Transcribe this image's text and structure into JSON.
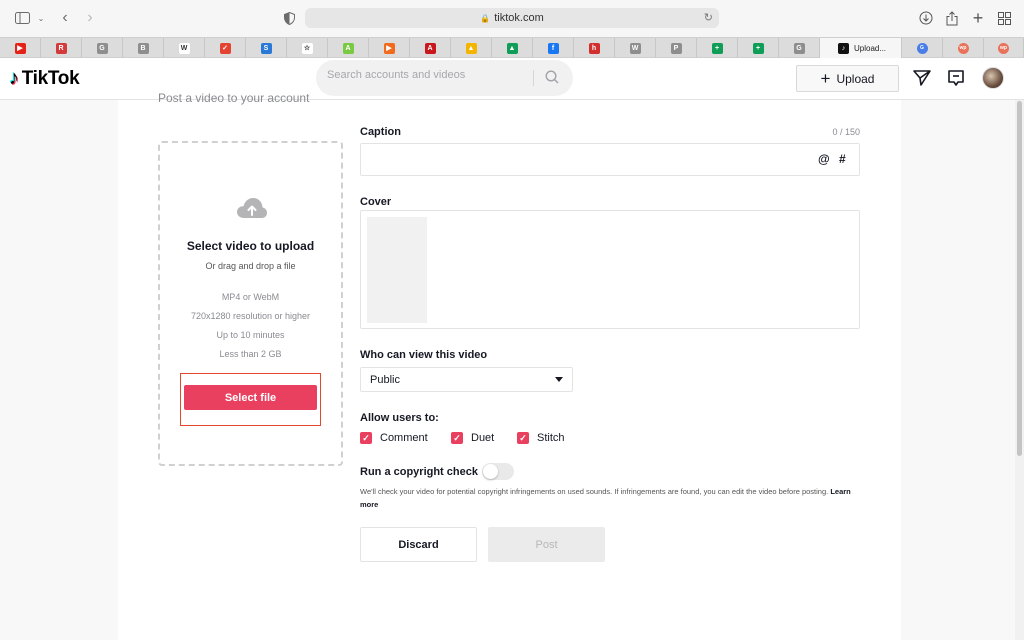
{
  "browser": {
    "url": "tiktok.com",
    "tabs": [
      {
        "name": "youtube",
        "color": "#e62117",
        "glyph": "▶"
      },
      {
        "name": "red-app",
        "color": "#d33b3b",
        "glyph": "R"
      },
      {
        "name": "g-gray-1",
        "color": "#8e8e8e",
        "glyph": "G"
      },
      {
        "name": "b-gray",
        "color": "#8e8e8e",
        "glyph": "B"
      },
      {
        "name": "wikipedia",
        "color": "#ffffff",
        "glyph": "W"
      },
      {
        "name": "todoist",
        "color": "#e44332",
        "glyph": "✓"
      },
      {
        "name": "s-blue",
        "color": "#2b79d6",
        "glyph": "S"
      },
      {
        "name": "star",
        "color": "#ffffff",
        "glyph": "☆"
      },
      {
        "name": "green-app",
        "color": "#7ac943",
        "glyph": "A"
      },
      {
        "name": "orange-play",
        "color": "#f26b1d",
        "glyph": "▶"
      },
      {
        "name": "acrobat",
        "color": "#c8181e",
        "glyph": "A"
      },
      {
        "name": "google-drive-1",
        "color": "#f4b400",
        "glyph": "▲"
      },
      {
        "name": "google-drive-2",
        "color": "#0f9d58",
        "glyph": "▲"
      },
      {
        "name": "facebook",
        "color": "#1877f2",
        "glyph": "f"
      },
      {
        "name": "hot",
        "color": "#d32f2f",
        "glyph": "h"
      },
      {
        "name": "w-gray",
        "color": "#8e8e8e",
        "glyph": "W"
      },
      {
        "name": "p-gray",
        "color": "#8e8e8e",
        "glyph": "P"
      },
      {
        "name": "sheets-1",
        "color": "#0f9d58",
        "glyph": "+"
      },
      {
        "name": "sheets-2",
        "color": "#0f9d58",
        "glyph": "+"
      },
      {
        "name": "g-gray-2",
        "color": "#8e8e8e",
        "glyph": "G"
      }
    ],
    "active_tab": "Upload...",
    "right_tabs": [
      {
        "name": "translate",
        "color": "#4a7de8",
        "glyph": "G"
      },
      {
        "name": "wp-1",
        "color": "#e8735a",
        "glyph": "wp"
      },
      {
        "name": "wp-2",
        "color": "#e8735a",
        "glyph": "wp"
      }
    ]
  },
  "header": {
    "logo": "TikTok",
    "search_placeholder": "Search accounts and videos",
    "upload_label": "Upload"
  },
  "form": {
    "top_text": "Post a video to your account",
    "dropzone": {
      "title": "Select video to upload",
      "subtitle": "Or drag and drop a file",
      "specs": [
        "MP4 or WebM",
        "720x1280 resolution or higher",
        "Up to 10 minutes",
        "Less than 2 GB"
      ],
      "button": "Select file"
    },
    "caption_label": "Caption",
    "caption_counter": "0 / 150",
    "caption_value": "",
    "at": "@",
    "hash": "#",
    "cover_label": "Cover",
    "privacy_label": "Who can view this video",
    "privacy_value": "Public",
    "allow_label": "Allow users to:",
    "allow": [
      "Comment",
      "Duet",
      "Stitch"
    ],
    "copyright_label": "Run a copyright check",
    "copyright_note": "We'll check your video for potential copyright infringements on used sounds. If infringements are found, you can edit the video before posting.",
    "learn_more": "Learn more",
    "discard": "Discard",
    "post": "Post"
  },
  "colors": {
    "accent": "#ea4060",
    "selection_outline": "#e5472c"
  }
}
